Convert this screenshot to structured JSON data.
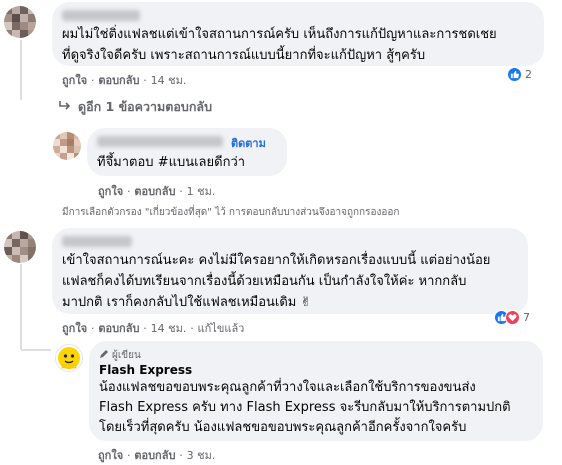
{
  "comments": [
    {
      "text": "ผมไม่ใช่ติ่งแฟลชแต่เข้าใจสถานการณ์ครับ เห็นถึงการแก้ปัญหาและการชดเชย\nที่ดูจริงใจดีครับ เพราะสถานการณ์แบบนี้ยากที่จะแก้ปัญหา สู้ๆครับ",
      "like": "ถูกใจ",
      "reply": "ตอบกลับ",
      "time": "14 ชม.",
      "reaction_count": "2",
      "view_replies": "ดูอีก 1 ข้อความตอบกลับ"
    },
    {
      "follow": "ติดตาม",
      "text": "ทีจึ้มาตอบ #แบนเลยดีกว่า",
      "like": "ถูกใจ",
      "reply": "ตอบกลับ",
      "time": "1 ชม."
    },
    {
      "text": "เข้าใจสถานการณ์นะคะ คงไม่มีใครอยากให้เกิดหรอกเรื่องแบบนี้ แต่อย่างน้อย\nแฟลชก็คงได้บทเรียนจากเรื่องนี้ด้วยเหมือนกัน เป็นกำลังใจให้ค่ะ หากกลับ\nมาปกติ เราก็คงกลับไปใช้แฟลชเหมือนเดิม ✌",
      "like": "ถูกใจ",
      "reply": "ตอบกลับ",
      "time": "14 ชม.",
      "edited": "แก้ไขแล้ว",
      "reaction_count": "7"
    },
    {
      "author_badge": "ผู้เขียน",
      "author": "Flash Express",
      "text": "น้องแฟลชขอขอบพระคุณลูกค้าที่วางใจและเลือกใช้บริการของขนส่ง\nFlash Express ครับ ทาง Flash Express จะรีบกลับมาให้บริการตามปกติ\nโดยเร็วที่สุดครับ น้องแฟลชขอขอบพระคุณลูกค้าอีกครั้งจากใจครับ",
      "like": "ถูกใจ",
      "reply": "ตอบกลับ",
      "time": "3 ชม."
    }
  ],
  "filter_note": "มีการเลือกตัวกรอง \"เกี่ยวข้องที่สุด\" ไว้ การตอบกลับบางส่วนจึงอาจถูกกรองออก",
  "separator": "·",
  "icons": {
    "like": "thumbs-up-icon",
    "love": "heart-icon",
    "reply_arrow": "reply-arrow-icon",
    "badge": "pen-icon"
  },
  "colors": {
    "like_blue": "#1877f2",
    "love_red": "#f33e58",
    "link_blue": "#216fdb",
    "bubble": "#f0f2f5",
    "muted": "#65676b",
    "logo_yellow": "#ffd400"
  }
}
